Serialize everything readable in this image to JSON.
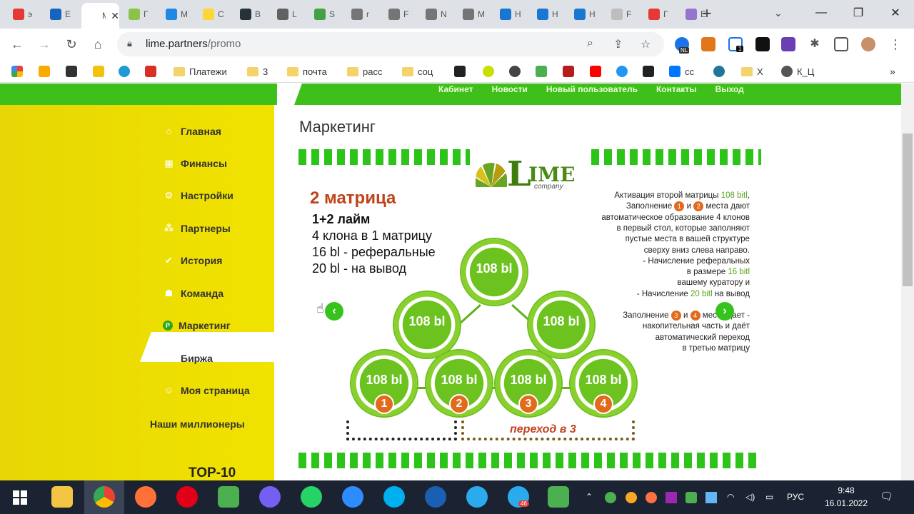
{
  "browser": {
    "tabs": [
      {
        "title": "э"
      },
      {
        "title": "E"
      },
      {
        "title": "М",
        "active": true
      },
      {
        "title": "Г"
      },
      {
        "title": "М"
      },
      {
        "title": "С"
      },
      {
        "title": "В"
      },
      {
        "title": "L"
      },
      {
        "title": "S"
      },
      {
        "title": "r"
      },
      {
        "title": "F"
      },
      {
        "title": "N"
      },
      {
        "title": "М"
      },
      {
        "title": "Н"
      },
      {
        "title": "Н"
      },
      {
        "title": "Н"
      },
      {
        "title": "F"
      },
      {
        "title": "Г"
      },
      {
        "title": "E"
      }
    ],
    "new_tab": "+",
    "url_host": "lime.partners",
    "url_path": "/promo",
    "ext_badge_nl": "NL",
    "ext_badge_1": "1"
  },
  "bookmarks": [
    {
      "label": "Платежи",
      "kind": "folder"
    },
    {
      "label": "3",
      "kind": "folder"
    },
    {
      "label": "почта",
      "kind": "folder"
    },
    {
      "label": "расс",
      "kind": "folder"
    },
    {
      "label": "соц",
      "kind": "folder"
    },
    {
      "label": "cc",
      "kind": "vk"
    },
    {
      "label": "Х",
      "kind": "folder"
    },
    {
      "label": "К_Ц",
      "kind": "site"
    }
  ],
  "site": {
    "topnav": [
      "Кабинет",
      "Новости",
      "Новый пользователь",
      "Контакты",
      "Выход"
    ],
    "sidebar": [
      {
        "label": "Главная",
        "icon": "home-icon"
      },
      {
        "label": "Финансы",
        "icon": "chart-icon"
      },
      {
        "label": "Настройки",
        "icon": "gear-icon"
      },
      {
        "label": "Партнеры",
        "icon": "partners-icon"
      },
      {
        "label": "История",
        "icon": "check-icon"
      },
      {
        "label": "Команда",
        "icon": "team-icon"
      },
      {
        "label": "Маркетинг",
        "icon": "marketing-icon",
        "active": true
      },
      {
        "label": "Биржа",
        "icon": "exchange-icon"
      },
      {
        "label": "Моя страница",
        "icon": "user-icon"
      }
    ],
    "millionaires": "Наши миллионеры",
    "top10": "TOP-10",
    "page_title": "Маркетинг"
  },
  "promo": {
    "logo_l": "L",
    "logo_ime": "IME",
    "logo_company": "company",
    "matrix_title": "2 матрица",
    "matrix_subtitle": "1+2 лайм",
    "matrix_lines": [
      "4 клона в 1 матрицу",
      "16 bl - реферальные",
      "20 bl -  на вывод"
    ],
    "circle_value": "108 bl",
    "positions": [
      "1",
      "2",
      "3",
      "4"
    ],
    "transition": "переход в 3",
    "right_text": {
      "l1a": "Активация второй матрицы ",
      "l1b": "108 bitl",
      "l1c": ",",
      "l2a": "Заполнение ",
      "n1": "1",
      "l2b": " и ",
      "n2": "2",
      "l2c": " места дают",
      "l3": "автоматическое образование 4 клонов",
      "l4": "в первый стол, которые  заполняют",
      "l5": "пустые места в вашей структуре",
      "l6": "сверху вниз слева направо.",
      "l7": "- Начисление реферальных",
      "l8a": "в размере ",
      "l8b": "16 bitl",
      "l9": "вашему куратору и",
      "l10a": "- Начисление ",
      "l10b": "20 bitl",
      "l10c": " на вывод",
      "l11a": "Заполнение ",
      "n3": "3",
      "l11b": " и ",
      "n4": "4",
      "l11c": " места дает -",
      "l12": "накопительная часть и даёт",
      "l13": "автоматический переход",
      "l14": "в третью матрицу"
    }
  },
  "taskbar": {
    "lang": "РУС",
    "time": "9:48",
    "date": "16.01.2022",
    "telegram_badge": "46"
  },
  "colors": {
    "site_green": "#3fbf1a",
    "sidebar_yellow": "#eddc02",
    "accent_orange": "#e26a1c",
    "title_red": "#c0431a"
  }
}
